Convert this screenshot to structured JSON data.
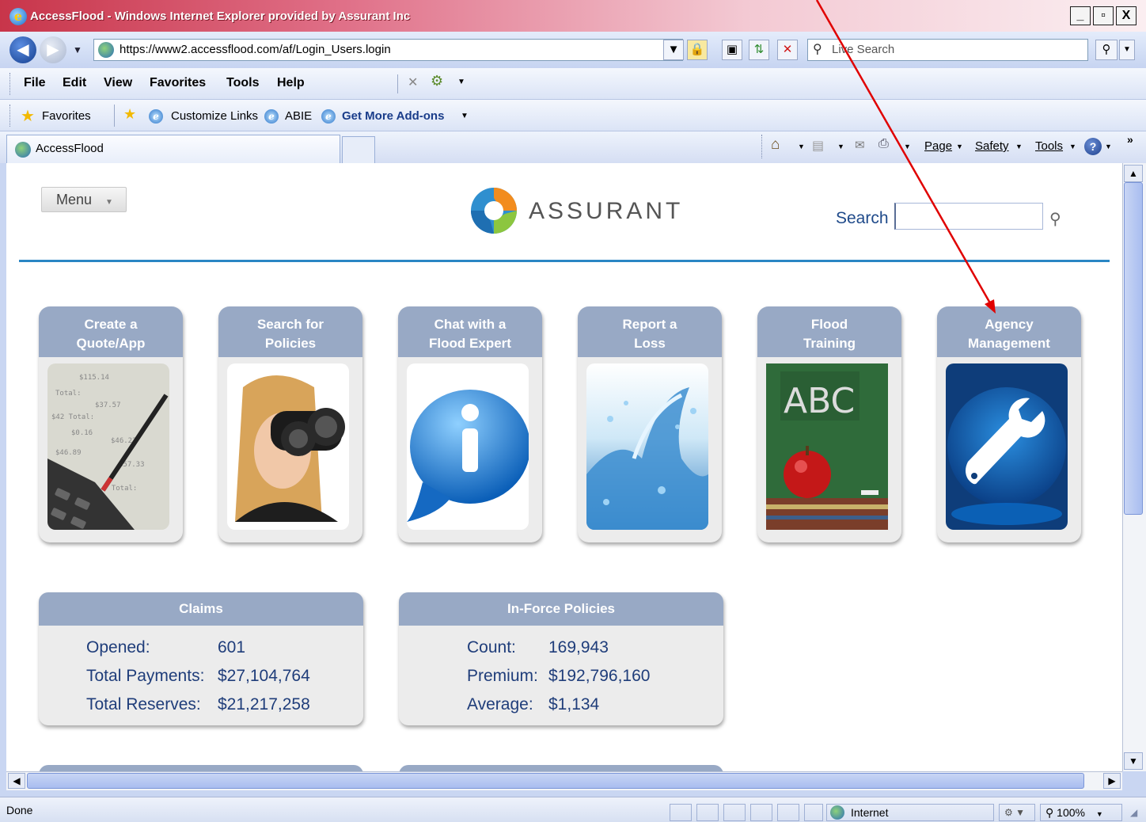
{
  "window": {
    "title": "AccessFlood - Windows Internet Explorer provided by Assurant Inc",
    "controls": {
      "minimize": "_",
      "maximize": "▫",
      "close": "X"
    }
  },
  "address_bar": {
    "url": "https://www2.accessflood.com/af/Login_Users.login",
    "search_placeholder": "Live Search"
  },
  "menu_bar": {
    "items": [
      "File",
      "Edit",
      "View",
      "Favorites",
      "Tools",
      "Help"
    ]
  },
  "favorites_bar": {
    "favorites_label": "Favorites",
    "links": [
      "Customize Links",
      "ABIE",
      "Get More Add-ons"
    ]
  },
  "tab_bar": {
    "active_tab": "AccessFlood",
    "commands": [
      "Page",
      "Safety",
      "Tools"
    ]
  },
  "page": {
    "menu_button": "Menu",
    "brand": "ASSURANT",
    "search_label": "Search",
    "tiles": [
      {
        "label": "Create a\nQuote/App",
        "icon": "calculator-receipt-image"
      },
      {
        "label": "Search for\nPolicies",
        "icon": "woman-binoculars-image"
      },
      {
        "label": "Chat with a\nFlood Expert",
        "icon": "info-speech-bubble-icon"
      },
      {
        "label": "Report a\nLoss",
        "icon": "water-splash-image"
      },
      {
        "label": "Flood\nTraining",
        "icon": "chalkboard-apple-image"
      },
      {
        "label": "Agency\nManagement",
        "icon": "wrench-icon"
      }
    ],
    "claims": {
      "title": "Claims",
      "rows": [
        {
          "label": "Opened:",
          "value": "601"
        },
        {
          "label": "Total Payments:",
          "value": "$27,104,764"
        },
        {
          "label": "Total Reserves:",
          "value": "$21,217,258"
        }
      ]
    },
    "inforce": {
      "title": "In-Force Policies",
      "rows": [
        {
          "label": "Count:",
          "value": "169,943"
        },
        {
          "label": "Premium:",
          "value": "$192,796,160"
        },
        {
          "label": "Average:",
          "value": "$1,134"
        }
      ]
    }
  },
  "status_bar": {
    "status": "Done",
    "zone": "Internet",
    "zoom": "100%"
  },
  "colors": {
    "tile_header": "#98a9c5",
    "divider": "#2a86c4",
    "annotation_arrow": "#e00000",
    "panel_text": "#1f3d7a"
  }
}
